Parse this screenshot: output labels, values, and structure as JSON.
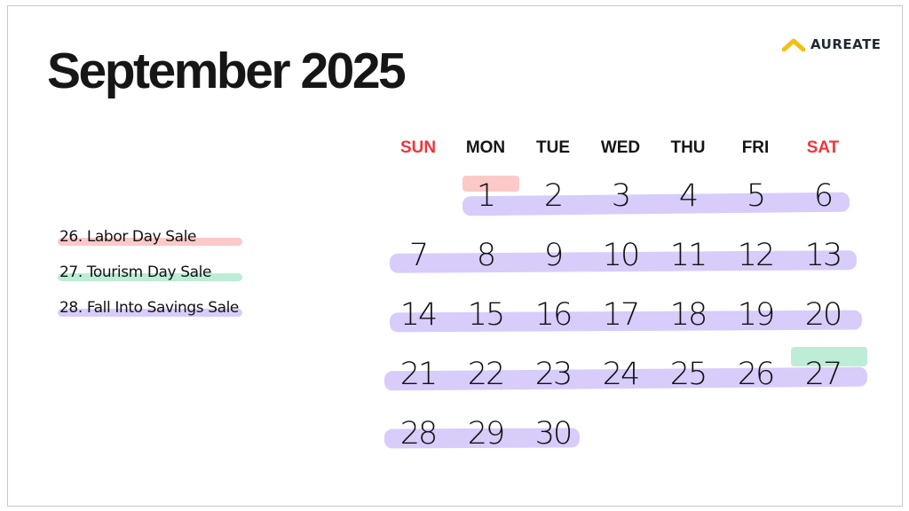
{
  "page": {
    "title": "September 2025",
    "brand": {
      "name": "AUREATE",
      "icon": "chevron-up-icon",
      "icon_color": "#f2c012"
    }
  },
  "legend": [
    {
      "label": "26. Labor Day Sale",
      "color": "#fcc9c9"
    },
    {
      "label": "27. Tourism Day Sale",
      "color": "#bdedd6"
    },
    {
      "label": "28. Fall Into Savings Sale",
      "color": "#d8ccfb"
    }
  ],
  "calendar": {
    "weekdays": [
      {
        "label": "SUN",
        "weekend": true
      },
      {
        "label": "MON",
        "weekend": false
      },
      {
        "label": "TUE",
        "weekend": false
      },
      {
        "label": "WED",
        "weekend": false
      },
      {
        "label": "THU",
        "weekend": false
      },
      {
        "label": "FRI",
        "weekend": false
      },
      {
        "label": "SAT",
        "weekend": true
      }
    ],
    "weeks": [
      [
        "",
        "1",
        "2",
        "3",
        "4",
        "5",
        "6"
      ],
      [
        "7",
        "8",
        "9",
        "10",
        "11",
        "12",
        "13"
      ],
      [
        "14",
        "15",
        "16",
        "17",
        "18",
        "19",
        "20"
      ],
      [
        "21",
        "22",
        "23",
        "24",
        "25",
        "26",
        "27"
      ],
      [
        "28",
        "29",
        "30",
        "",
        "",
        "",
        ""
      ]
    ],
    "highlights": [
      {
        "event": "Labor Day Sale",
        "day": "1",
        "color": "#fcc9c9"
      },
      {
        "event": "Tourism Day Sale",
        "day": "27",
        "color": "#bdedd6"
      },
      {
        "event": "Fall Into Savings Sale",
        "range": [
          "1",
          "30"
        ],
        "color": "#d8ccfb"
      }
    ],
    "weekday_color": "#151515",
    "weekend_color": "#f2353a"
  }
}
